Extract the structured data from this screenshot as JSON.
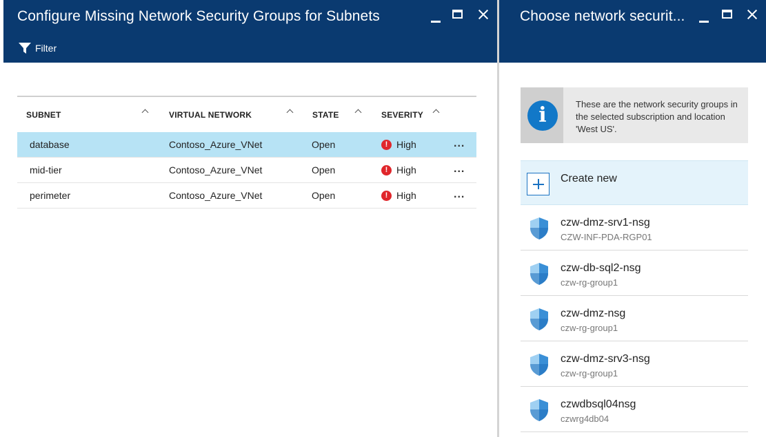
{
  "left_blade": {
    "title": "Configure Missing Network Security Groups for Subnets",
    "filter_label": "Filter",
    "columns": [
      "SUBNET",
      "VIRTUAL NETWORK",
      "STATE",
      "SEVERITY"
    ],
    "rows": [
      {
        "subnet": "database",
        "vnet": "Contoso_Azure_VNet",
        "state": "Open",
        "severity": "High",
        "selected": true
      },
      {
        "subnet": "mid-tier",
        "vnet": "Contoso_Azure_VNet",
        "state": "Open",
        "severity": "High",
        "selected": false
      },
      {
        "subnet": "perimeter",
        "vnet": "Contoso_Azure_VNet",
        "state": "Open",
        "severity": "High",
        "selected": false
      }
    ],
    "more_label": "..."
  },
  "right_blade": {
    "title": "Choose network securit...",
    "info_text": "These are the network security groups in the selected subscription and location 'West US'.",
    "create_new_label": "Create new",
    "nsgs": [
      {
        "name": "czw-dmz-srv1-nsg",
        "rg": "CZW-INF-PDA-RGP01"
      },
      {
        "name": "czw-db-sql2-nsg",
        "rg": "czw-rg-group1"
      },
      {
        "name": "czw-dmz-nsg",
        "rg": "czw-rg-group1"
      },
      {
        "name": "czw-dmz-srv3-nsg",
        "rg": "czw-rg-group1"
      },
      {
        "name": "czwdbsql04nsg",
        "rg": "czwrg4db04"
      }
    ]
  },
  "colors": {
    "header_bg": "#0a3a70",
    "selected_row": "#b7e3f5",
    "severity_high": "#e0262b",
    "info_icon": "#1278c8",
    "shield": "#3a8fd6"
  },
  "icons": {
    "filter": "filter-icon",
    "sort": "chevron-up-icon",
    "severity": "error-circle-icon",
    "info": "info-icon",
    "create": "plus-icon",
    "nsg": "shield-icon",
    "minimize": "minimize-icon",
    "maximize": "maximize-icon",
    "close": "close-icon"
  }
}
